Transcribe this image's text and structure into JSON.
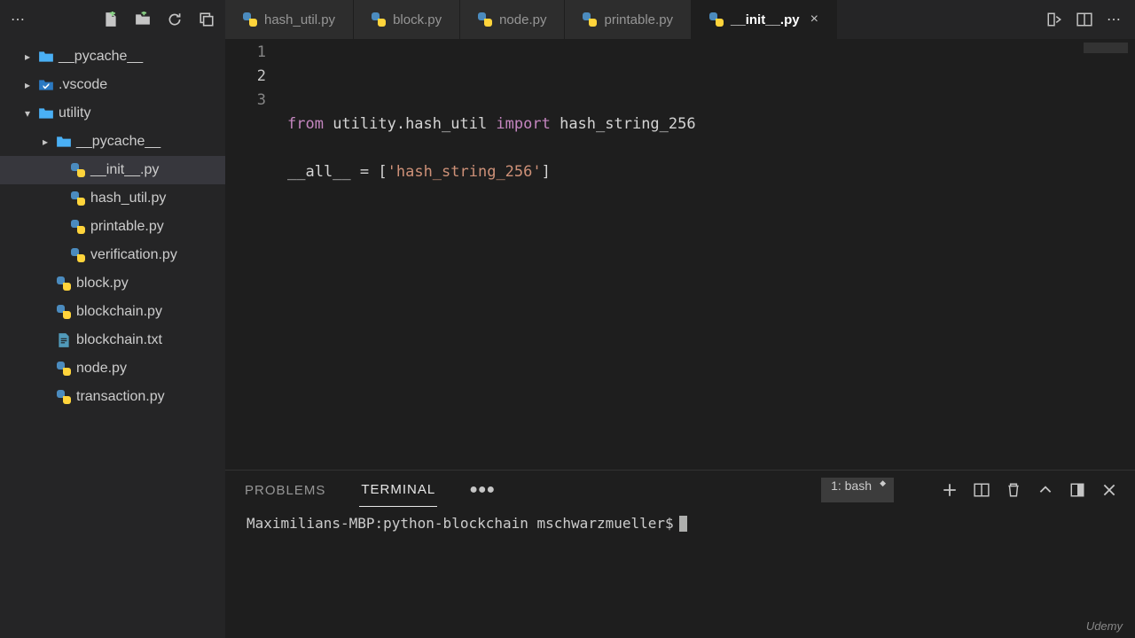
{
  "sidebar_actions": {
    "new_file": "New File",
    "new_folder": "New Folder",
    "refresh": "Refresh",
    "collapse": "Collapse"
  },
  "tabs": [
    {
      "label": "hash_util.py",
      "active": false
    },
    {
      "label": "block.py",
      "active": false
    },
    {
      "label": "node.py",
      "active": false
    },
    {
      "label": "printable.py",
      "active": false
    },
    {
      "label": "__init__.py",
      "active": true
    }
  ],
  "explorer": [
    {
      "type": "folder",
      "name": "__pycache__",
      "depth": 1,
      "open": false
    },
    {
      "type": "vsfolder",
      "name": ".vscode",
      "depth": 1,
      "open": false
    },
    {
      "type": "folder",
      "name": "utility",
      "depth": 1,
      "open": true
    },
    {
      "type": "folder",
      "name": "__pycache__",
      "depth": 2,
      "open": false
    },
    {
      "type": "py",
      "name": "__init__.py",
      "depth": 3,
      "selected": true
    },
    {
      "type": "py",
      "name": "hash_util.py",
      "depth": 3
    },
    {
      "type": "py",
      "name": "printable.py",
      "depth": 3
    },
    {
      "type": "py",
      "name": "verification.py",
      "depth": 3
    },
    {
      "type": "py",
      "name": "block.py",
      "depth": 2
    },
    {
      "type": "py",
      "name": "blockchain.py",
      "depth": 2
    },
    {
      "type": "txt",
      "name": "blockchain.txt",
      "depth": 2
    },
    {
      "type": "py",
      "name": "node.py",
      "depth": 2
    },
    {
      "type": "py",
      "name": "transaction.py",
      "depth": 2
    }
  ],
  "editor": {
    "lines": [
      {
        "n": 1,
        "tokens": [
          {
            "t": "from",
            "c": "tok-k"
          },
          {
            "t": " utility.hash_util ",
            "c": "tok-n"
          },
          {
            "t": "import",
            "c": "tok-k"
          },
          {
            "t": " hash_string_256",
            "c": "tok-n"
          }
        ]
      },
      {
        "n": 2,
        "tokens": []
      },
      {
        "n": 3,
        "tokens": [
          {
            "t": "__all__ ",
            "c": "tok-n"
          },
          {
            "t": "=",
            "c": "tok-p"
          },
          {
            "t": " [",
            "c": "tok-p"
          },
          {
            "t": "'hash_string_256'",
            "c": "tok-s"
          },
          {
            "t": "]",
            "c": "tok-p"
          }
        ]
      }
    ],
    "current_line": 2
  },
  "panel": {
    "tabs": {
      "problems": "PROBLEMS",
      "terminal": "TERMINAL"
    },
    "terminal_selector": "1: bash",
    "prompt": "Maximilians-MBP:python-blockchain mschwarzmueller$"
  },
  "watermark": "Udemy"
}
